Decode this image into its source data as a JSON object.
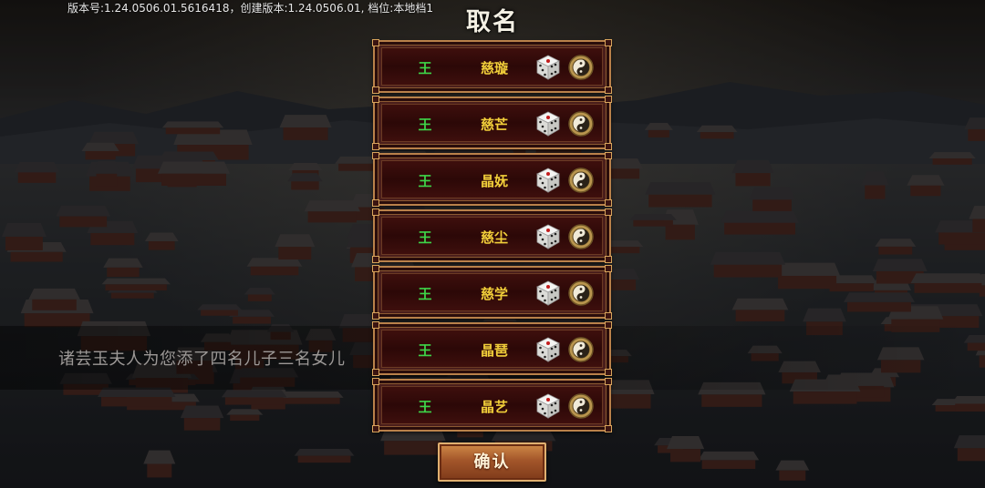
{
  "header": {
    "version_info": "版本号:1.24.0506.01.5616418，创建版本:1.24.0506.01, 档位:本地档1",
    "title": "取名"
  },
  "message": "诸芸玉夫人为您添了四名儿子三名女儿",
  "name_rows": [
    {
      "surname": "王",
      "given_name": "慈璇"
    },
    {
      "surname": "王",
      "given_name": "慈芒"
    },
    {
      "surname": "王",
      "given_name": "晶妩"
    },
    {
      "surname": "王",
      "given_name": "慈尘"
    },
    {
      "surname": "王",
      "given_name": "慈学"
    },
    {
      "surname": "王",
      "given_name": "晶琶"
    },
    {
      "surname": "王",
      "given_name": "晶艺"
    }
  ],
  "confirm_label": "确认",
  "icons": {
    "random": "dice-icon",
    "fate": "yin-yang-icon"
  },
  "colors": {
    "surname": "#3ed448",
    "given_name": "#f2cf3a",
    "row_fill": "#2c0807",
    "row_border": "#b9814a",
    "confirm_button": "#a3562a"
  }
}
